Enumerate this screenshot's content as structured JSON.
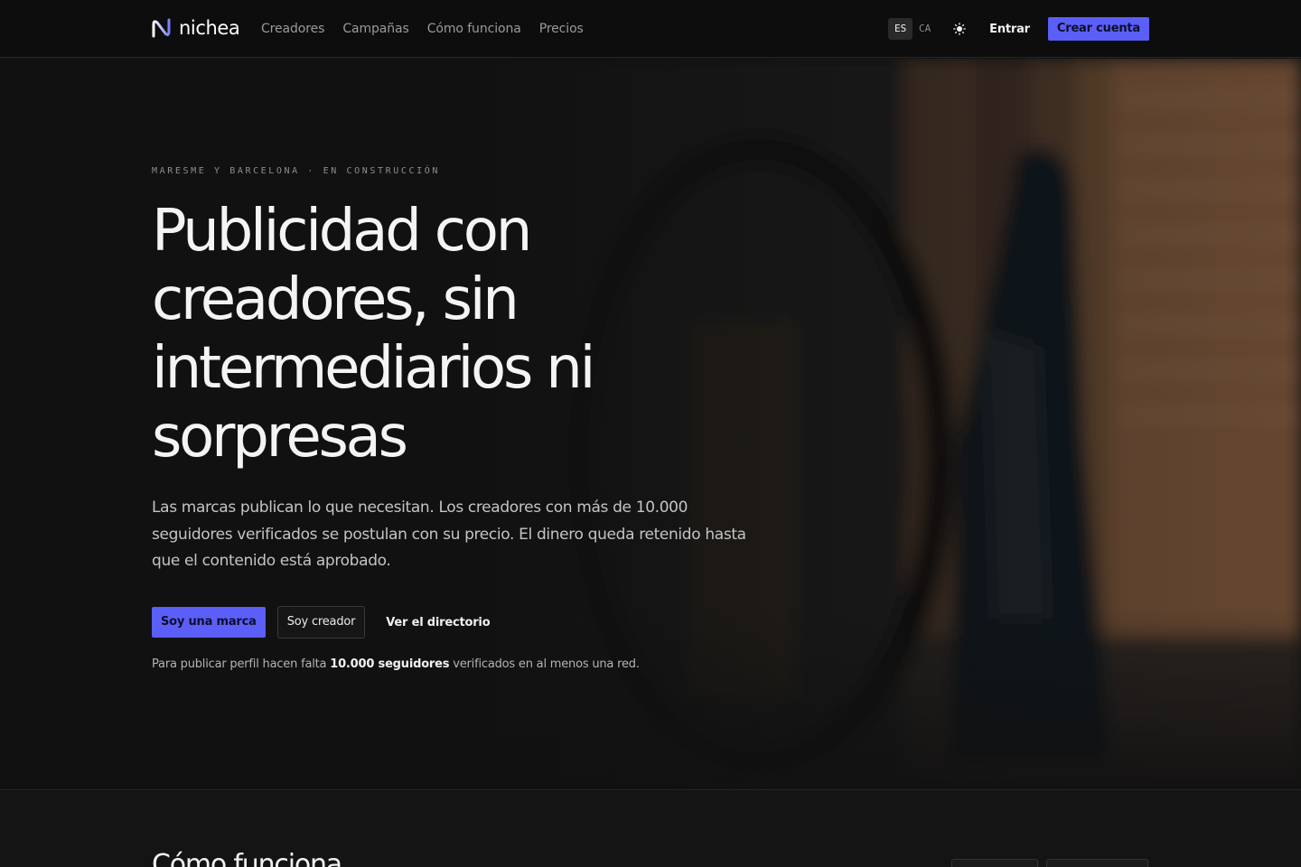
{
  "header": {
    "brand": "nichea",
    "nav": [
      "Creadores",
      "Campañas",
      "Cómo funciona",
      "Precios"
    ],
    "languages": [
      "ES",
      "CA"
    ],
    "active_language": "ES",
    "theme_icon": "sun-icon",
    "login": "Entrar",
    "signup": "Crear cuenta"
  },
  "hero": {
    "eyebrow": "MARESME Y BARCELONA · EN CONSTRUCCIÓN",
    "title": "Publicidad con creadores, sin intermediarios ni sorpresas",
    "lead": "Las marcas publican lo que necesitan. Los creadores con más de 10.000 seguidores verificados se postulan con su precio. El dinero queda retenido hasta que el contenido está aprobado.",
    "primary_cta": "Soy una marca",
    "secondary_cta": "Soy creador",
    "link_cta": "Ver el directorio",
    "note_prefix": "Para publicar perfil hacen falta ",
    "note_bold": "10.000 seguidores",
    "note_suffix": " verificados en al menos una red."
  },
  "section": {
    "title": "Cómo funciona"
  },
  "colors": {
    "accent": "#5b5ef7",
    "background": "#111111",
    "header_background": "#0d0d0d"
  }
}
